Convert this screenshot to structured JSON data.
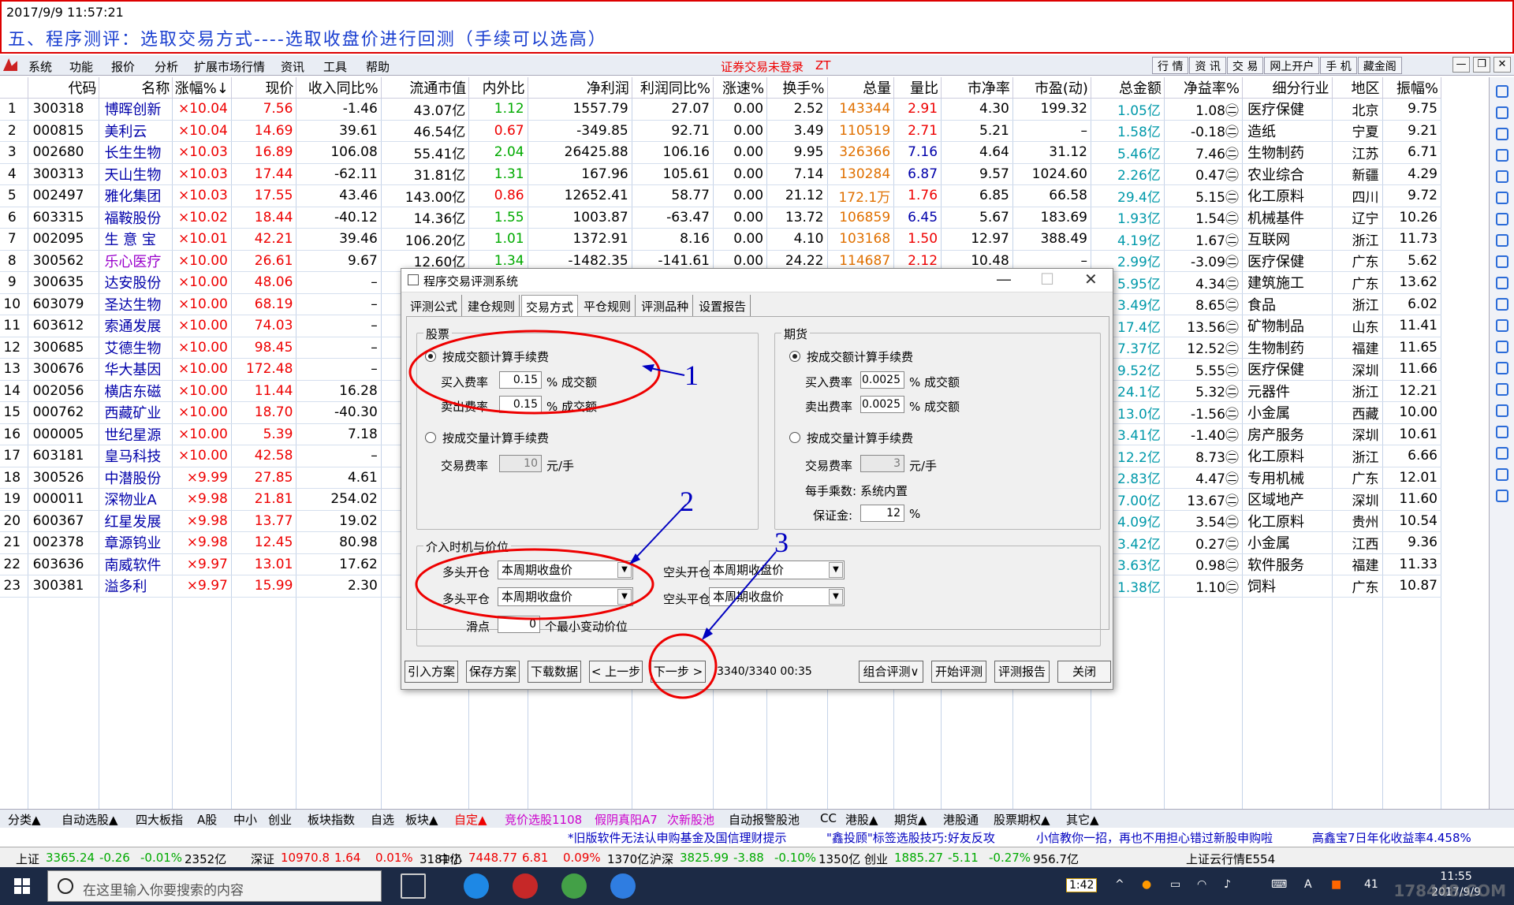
{
  "annotation": {
    "timestamp": "2017/9/9 11:57:21",
    "title": "五、程序测评：选取交易方式----选取收盘价进行回测（手续可以选高）"
  },
  "menu": {
    "items": [
      "系统",
      "功能",
      "报价",
      "分析",
      "扩展市场行情",
      "资讯",
      "工具",
      "帮助"
    ],
    "warning": "证券交易未登录",
    "warning_tag": "ZT",
    "right_buttons": [
      "行 情",
      "资 讯",
      "交 易",
      "网上开户",
      "手 机",
      "藏金阁"
    ]
  },
  "table": {
    "headers": [
      "",
      "代码",
      "名称",
      "涨幅%↓",
      "现价",
      "收入同比%",
      "流通市值",
      "内外比",
      "净利润",
      "利润同比%",
      "涨速%",
      "换手%",
      "总量",
      "量比",
      "市净率",
      "市盈(动)",
      "总金额",
      "净益率%",
      "细分行业",
      "地区",
      "振幅%"
    ],
    "rows": [
      [
        "1",
        "300318",
        "博晖创新",
        "10.04",
        "7.56",
        "-1.46",
        "43.07亿",
        "1.12",
        "1557.79",
        "27.07",
        "0.00",
        "2.52",
        "143344",
        "2.91",
        "4.30",
        "199.32",
        "1.05亿",
        "1.08㊁",
        "医疗保健",
        "北京",
        "9.75"
      ],
      [
        "2",
        "000815",
        "美利云",
        "10.04",
        "14.69",
        "39.61",
        "46.54亿",
        "0.67",
        "-349.85",
        "92.71",
        "0.00",
        "3.49",
        "110519",
        "2.71",
        "5.21",
        "–",
        "1.58亿",
        "-0.18㊁",
        "造纸",
        "宁夏",
        "9.21"
      ],
      [
        "3",
        "002680",
        "长生生物",
        "10.03",
        "16.89",
        "106.08",
        "55.41亿",
        "2.04",
        "26425.88",
        "106.16",
        "0.00",
        "9.95",
        "326366",
        "7.16",
        "4.64",
        "31.12",
        "5.46亿",
        "7.46㊁",
        "生物制药",
        "江苏",
        "6.71"
      ],
      [
        "4",
        "300313",
        "天山生物",
        "10.03",
        "17.44",
        "-62.11",
        "31.81亿",
        "1.31",
        "167.96",
        "105.61",
        "0.00",
        "7.14",
        "130284",
        "6.87",
        "9.57",
        "1024.60",
        "2.26亿",
        "0.47㊁",
        "农业综合",
        "新疆",
        "4.29"
      ],
      [
        "5",
        "002497",
        "雅化集团",
        "10.03",
        "17.55",
        "43.46",
        "143.00亿",
        "0.86",
        "12652.41",
        "58.77",
        "0.00",
        "21.12",
        "172.1万",
        "1.76",
        "6.85",
        "66.58",
        "29.4亿",
        "5.15㊁",
        "化工原料",
        "四川",
        "9.72"
      ],
      [
        "6",
        "603315",
        "福鞍股份",
        "10.02",
        "18.44",
        "-40.12",
        "14.36亿",
        "1.55",
        "1003.87",
        "-63.47",
        "0.00",
        "13.72",
        "106859",
        "6.45",
        "5.67",
        "183.69",
        "1.93亿",
        "1.54㊁",
        "机械基件",
        "辽宁",
        "10.26"
      ],
      [
        "7",
        "002095",
        "生 意 宝",
        "10.01",
        "42.21",
        "39.46",
        "106.20亿",
        "1.01",
        "1372.91",
        "8.16",
        "0.00",
        "4.10",
        "103168",
        "1.50",
        "12.97",
        "388.49",
        "4.19亿",
        "1.67㊁",
        "互联网",
        "浙江",
        "11.73"
      ],
      [
        "8",
        "300562",
        "乐心医疗",
        "10.00",
        "26.61",
        "9.67",
        "12.60亿",
        "1.34",
        "-1482.35",
        "-141.61",
        "0.00",
        "24.22",
        "114687",
        "2.12",
        "10.48",
        "–",
        "2.99亿",
        "-3.09㊁",
        "医疗保健",
        "广东",
        "5.62"
      ],
      [
        "9",
        "300635",
        "达安股份",
        "10.00",
        "48.06",
        "–",
        "",
        "",
        "",
        "",
        "",
        "",
        "",
        "",
        "",
        "",
        "5.95亿",
        "4.34㊁",
        "建筑施工",
        "广东",
        "13.62"
      ],
      [
        "10",
        "603079",
        "圣达生物",
        "10.00",
        "68.19",
        "–",
        "",
        "",
        "",
        "",
        "",
        "",
        "",
        "",
        "",
        "",
        "3.49亿",
        "8.65㊁",
        "食品",
        "浙江",
        "6.02"
      ],
      [
        "11",
        "603612",
        "索通发展",
        "10.00",
        "74.03",
        "–",
        "",
        "",
        "",
        "",
        "",
        "",
        "",
        "",
        "",
        "",
        "17.4亿",
        "13.56㊁",
        "矿物制品",
        "山东",
        "11.41"
      ],
      [
        "12",
        "300685",
        "艾德生物",
        "10.00",
        "98.45",
        "–",
        "",
        "",
        "",
        "",
        "",
        "",
        "",
        "",
        "",
        "",
        "7.37亿",
        "12.52㊁",
        "生物制药",
        "福建",
        "11.65"
      ],
      [
        "13",
        "300676",
        "华大基因",
        "10.00",
        "172.48",
        "–",
        "",
        "",
        "",
        "",
        "",
        "",
        "",
        "",
        "",
        "",
        "9.52亿",
        "5.55㊁",
        "医疗保健",
        "深圳",
        "11.66"
      ],
      [
        "14",
        "002056",
        "横店东磁",
        "10.00",
        "11.44",
        "16.28",
        "",
        "",
        "",
        "",
        "",
        "",
        "",
        "",
        "",
        "",
        "24.1亿",
        "5.32㊁",
        "元器件",
        "浙江",
        "12.21"
      ],
      [
        "15",
        "000762",
        "西藏矿业",
        "10.00",
        "18.70",
        "-40.30",
        "",
        "",
        "",
        "",
        "",
        "",
        "",
        "",
        "",
        "",
        "13.0亿",
        "-1.56㊁",
        "小金属",
        "西藏",
        "10.00"
      ],
      [
        "16",
        "000005",
        "世纪星源",
        "10.00",
        "5.39",
        "7.18",
        "",
        "",
        "",
        "",
        "",
        "",
        "",
        "",
        "",
        "",
        "3.41亿",
        "-1.40㊁",
        "房产服务",
        "深圳",
        "10.61"
      ],
      [
        "17",
        "603181",
        "皇马科技",
        "10.00",
        "42.58",
        "–",
        "",
        "",
        "",
        "",
        "",
        "",
        "",
        "",
        "",
        "",
        "12.2亿",
        "8.73㊁",
        "化工原料",
        "浙江",
        "6.66"
      ],
      [
        "18",
        "300526",
        "中潜股份",
        "9.99",
        "27.85",
        "4.61",
        "",
        "",
        "",
        "",
        "",
        "",
        "",
        "",
        "",
        "",
        "2.83亿",
        "4.47㊁",
        "专用机械",
        "广东",
        "12.01"
      ],
      [
        "19",
        "000011",
        "深物业A",
        "9.98",
        "21.81",
        "254.02",
        "",
        "",
        "",
        "",
        "",
        "",
        "",
        "",
        "",
        "",
        "7.00亿",
        "13.67㊁",
        "区域地产",
        "深圳",
        "11.60"
      ],
      [
        "20",
        "600367",
        "红星发展",
        "9.98",
        "13.77",
        "19.02",
        "",
        "",
        "",
        "",
        "",
        "",
        "",
        "",
        "",
        "",
        "4.09亿",
        "3.54㊁",
        "化工原料",
        "贵州",
        "10.54"
      ],
      [
        "21",
        "002378",
        "章源钨业",
        "9.98",
        "12.45",
        "80.98",
        "",
        "",
        "",
        "",
        "",
        "",
        "",
        "",
        "",
        "",
        "3.42亿",
        "0.27㊁",
        "小金属",
        "江西",
        "9.36"
      ],
      [
        "22",
        "603636",
        "南威软件",
        "9.97",
        "13.01",
        "17.62",
        "",
        "",
        "",
        "",
        "",
        "",
        "",
        "",
        "",
        "",
        "3.63亿",
        "0.98㊁",
        "软件服务",
        "福建",
        "11.33"
      ],
      [
        "23",
        "300381",
        "溢多利",
        "9.97",
        "15.99",
        "2.30",
        "",
        "",
        "",
        "",
        "",
        "",
        "",
        "",
        "",
        "",
        "1.38亿",
        "1.10㊁",
        "饲料",
        "广东",
        "10.87"
      ]
    ]
  },
  "dialog": {
    "title": "程序交易评测系统",
    "tabs": [
      "评测公式",
      "建仓规则",
      "交易方式",
      "平仓规则",
      "评测品种",
      "设置报告"
    ],
    "stock": {
      "legend": "股票",
      "opt_amount": "按成交额计算手续费",
      "buy_label": "买入费率",
      "buy_value": "0.15",
      "sell_label": "卖出费率",
      "sell_value": "0.15",
      "pct_unit": "% 成交额",
      "opt_volume": "按成交量计算手续费",
      "trade_label": "交易费率",
      "trade_value": "10",
      "trade_unit": "元/手"
    },
    "futures": {
      "legend": "期货",
      "opt_amount": "按成交额计算手续费",
      "buy_label": "买入费率",
      "buy_value": "0.0025",
      "sell_label": "卖出费率",
      "sell_value": "0.0025",
      "pct_unit": "% 成交额",
      "opt_volume": "按成交量计算手续费",
      "trade_label": "交易费率",
      "trade_value": "3",
      "trade_unit": "元/手",
      "mult_label": "每手乘数:",
      "mult_value": "系统内置",
      "margin_label": "保证金:",
      "margin_value": "12",
      "margin_unit": "%"
    },
    "entry": {
      "legend": "介入时机与价位",
      "long_open": "多头开仓",
      "long_close": "多头平仓",
      "short_open": "空头开仓",
      "short_close": "空头平仓",
      "price_option": "本周期收盘价",
      "slip_label": "滑点",
      "slip_value": "0",
      "slip_unit": "个最小变动价位"
    },
    "buttons": [
      "引入方案",
      "保存方案",
      "下载数据",
      "< 上一步",
      "下一步 >",
      "组合评测∨",
      "开始评测",
      "评测报告",
      "关闭"
    ],
    "status": "3340/3340 00:35"
  },
  "callouts": [
    "1",
    "2",
    "3"
  ],
  "bottom_tabs": [
    "分类▲",
    "自动选股▲",
    "四大板指",
    "A股",
    "中小",
    "创业",
    "板块指数",
    "自选",
    "板块▲",
    "自定▲",
    "竞价选股1108",
    "假阴真阳A7",
    "次新股池",
    "自动报警股池",
    "CC",
    "港股▲",
    "期货▲",
    "港股通",
    "股票期权▲",
    "其它▲"
  ],
  "ticker": [
    "*旧版软件无法认申购基金及国信理财提示",
    "\"鑫投顾\"标签选股技巧:好友反攻",
    "小信教你一招，再也不用担心错过新股申购啦",
    "高鑫宝7日年化收益率4.458%"
  ],
  "index_bar": [
    {
      "name": "上证",
      "val": "3365.24",
      "chg": "-0.26",
      "pct": "-0.01%",
      "amt": "2352亿"
    },
    {
      "name": "深证",
      "val": "10970.8",
      "chg": "1.64",
      "pct": "0.01%",
      "amt": "3181亿"
    },
    {
      "name": "中小",
      "val": "7448.77",
      "chg": "6.81",
      "pct": "0.09%",
      "amt": "1370亿"
    },
    {
      "name": "沪深",
      "val": "3825.99",
      "chg": "-3.88",
      "pct": "-0.10%",
      "amt": "1350亿"
    },
    {
      "name": "创业",
      "val": "1885.27",
      "chg": "-5.11",
      "pct": "-0.27%",
      "amt": "956.7亿"
    }
  ],
  "index_extra": "上证云行情E554",
  "taskbar": {
    "search_placeholder": "在这里输入你要搜索的内容",
    "time": "11:55",
    "date": "2017/9/9",
    "tray_num": "41",
    "chip": "1:42"
  },
  "watermark": "178448.COM",
  "colors": {
    "up": "#e00000",
    "down": "#00a000",
    "accent": "#1a3fd0",
    "annotation": "#0000c0"
  }
}
